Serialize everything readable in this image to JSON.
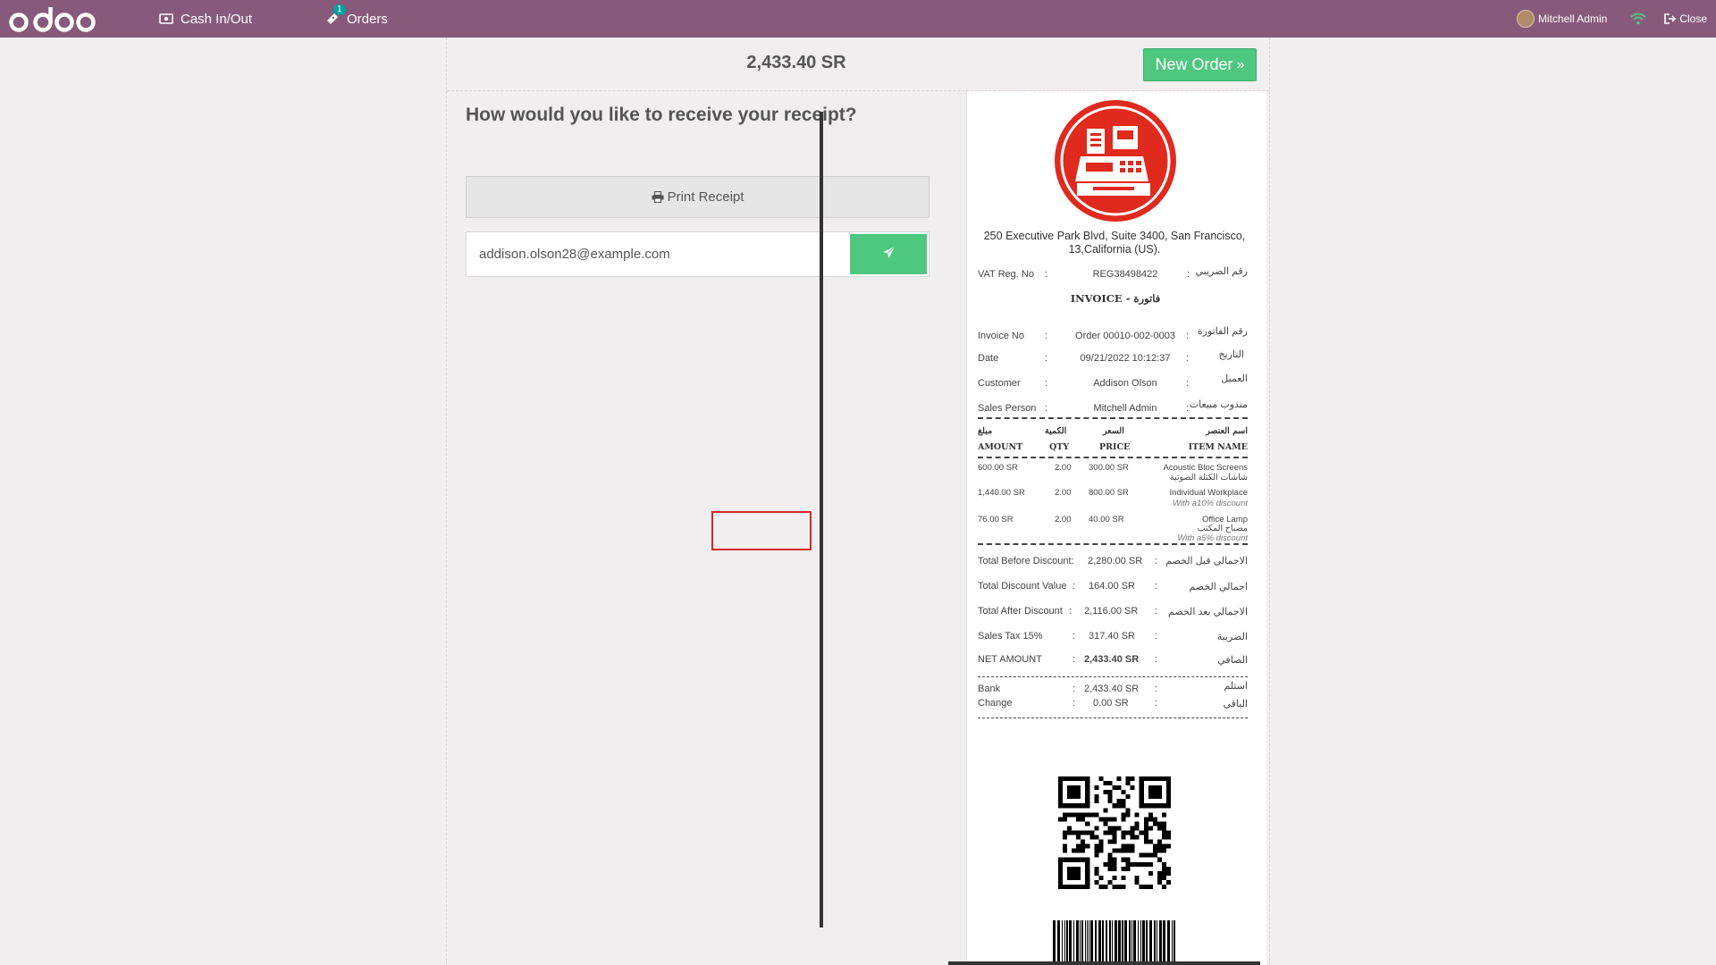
{
  "navbar": {
    "logo": "odoo",
    "cash_label": "Cash In/Out",
    "orders_label": "Orders",
    "orders_badge": "1",
    "user_name": "Mitchell Admin",
    "close_label": "Close",
    "colors": {
      "bar": "#875a7b"
    }
  },
  "screen": {
    "total": "2,433.40 SR",
    "new_order_label": "New Order",
    "question": "How would you like to receive your receipt?",
    "print_label": "Print Receipt",
    "email_value": "addison.olson28@example.com",
    "colors": {
      "accent": "#4ec77f"
    }
  },
  "receipt": {
    "address": "250 Executive Park Blvd, Suite 3400, San Francisco, 13,California (US).",
    "vat": {
      "label": "VAT Reg. No",
      "value": "REG38498422",
      "ar": "رقم الضريبي"
    },
    "title": "INVOICE - فاتورة",
    "info": [
      {
        "label": "Invoice No",
        "value": "Order 00010-002-0003",
        "ar": "رقم الفاتورة"
      },
      {
        "label": "Date",
        "value": "09/21/2022 10:12:37",
        "ar": "التاريخ"
      },
      {
        "label": "Customer",
        "value": "Addison Olson",
        "ar": "العميل"
      },
      {
        "label": "Sales Person",
        "value": "Mitchell Admin",
        "ar": "مندوب مبيعات"
      }
    ],
    "headers": {
      "amount_ar": "مبلغ",
      "qty_ar": "الكمية",
      "price_ar": "السعر",
      "name_ar": "اسم العنصر",
      "amount": "AMOUNT",
      "qty": "QTY",
      "price": "PRICE",
      "name": "ITEM NAME"
    },
    "items": [
      {
        "amount": "600.00 SR",
        "qty": "2.00",
        "price": "300.00 SR",
        "name": "Acoustic Bloc Screens",
        "name_ar": "شاشات الكتلة الصوتية",
        "discount": ""
      },
      {
        "amount": "1,440.00 SR",
        "qty": "2.00",
        "price": "800.00 SR",
        "name": "Individual Workplace",
        "name_ar": "",
        "discount": "With a10% discount"
      },
      {
        "amount": "76.00 SR",
        "qty": "2.00",
        "price": "40.00 SR",
        "name": "Office Lamp",
        "name_ar": "مصباح المكتب",
        "discount": "With a5% discount"
      }
    ],
    "totals": [
      {
        "label": "Total Before Discount:",
        "value": "2,280.00 SR",
        "ar": "الاجمالي قبل الخصم"
      },
      {
        "label": "Total Discount Value",
        "value": "164.00 SR",
        "ar": "اجمالي الخصم"
      },
      {
        "label": "Total After Discount",
        "value": "2,116.00 SR",
        "ar": "الاجمالي بعد الخصم"
      },
      {
        "label": "Sales Tax 15%",
        "value": "317.40 SR",
        "ar": "الضريبة"
      },
      {
        "label": "NET AMOUNT",
        "value": "2,433.40 SR",
        "ar": "الصافي"
      }
    ],
    "payment": [
      {
        "label": "Bank",
        "value": "2,433.40 SR",
        "ar": "استلم"
      },
      {
        "label": "Change",
        "value": "0.00 SR",
        "ar": "الباقي"
      }
    ],
    "barcode_number": "8594874296117",
    "colors": {
      "logo_red": "#e02a1e"
    }
  }
}
